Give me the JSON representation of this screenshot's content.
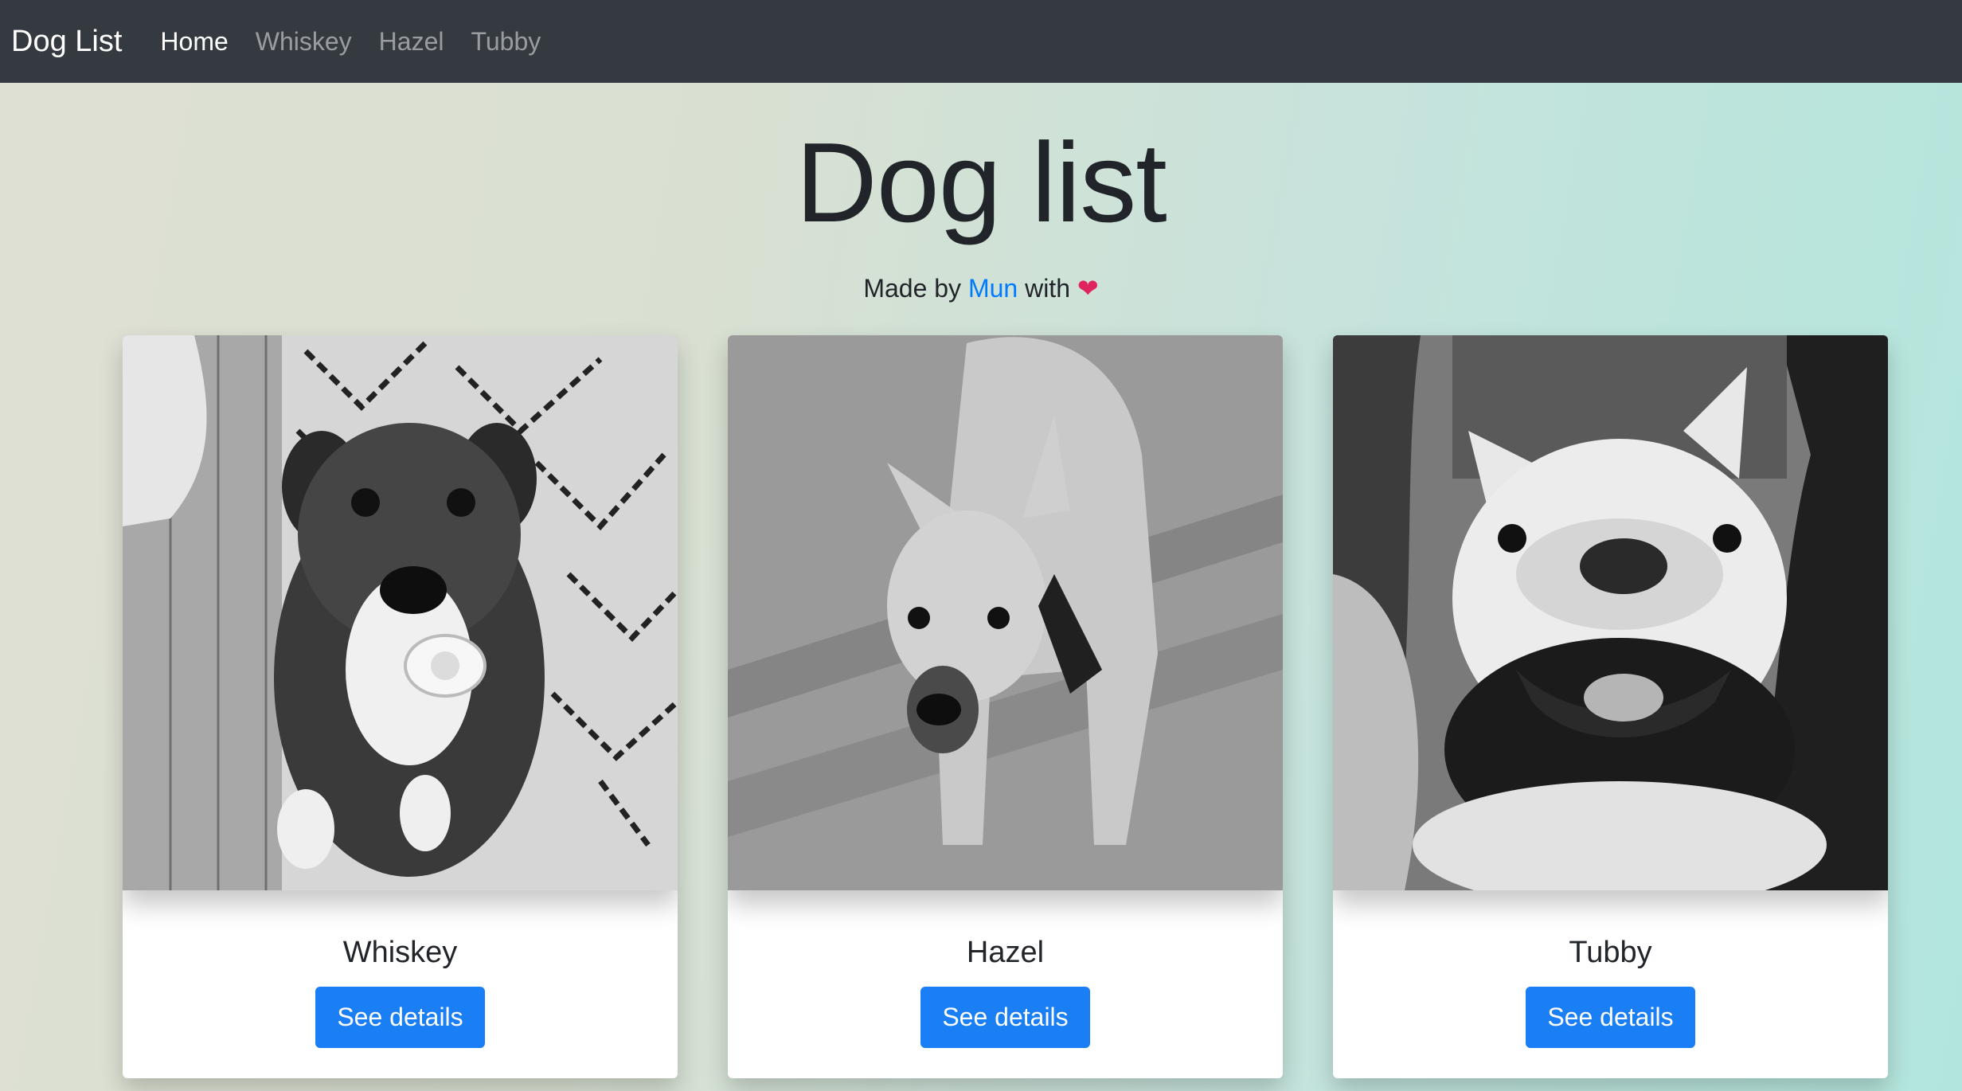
{
  "navbar": {
    "brand": "Dog List",
    "links": [
      {
        "label": "Home",
        "active": true
      },
      {
        "label": "Whiskey",
        "active": false
      },
      {
        "label": "Hazel",
        "active": false
      },
      {
        "label": "Tubby",
        "active": false
      }
    ]
  },
  "header": {
    "title": "Dog list",
    "subtitle_prefix": "Made by",
    "author_link": "Mun",
    "subtitle_suffix": "with",
    "heart_icon": "heart-icon"
  },
  "cards": [
    {
      "name": "Whiskey",
      "button_label": "See details"
    },
    {
      "name": "Hazel",
      "button_label": "See details"
    },
    {
      "name": "Tubby",
      "button_label": "See details"
    }
  ],
  "colors": {
    "navbar": "#343a40",
    "link": "#007bff",
    "button": "#1a7ff5"
  }
}
